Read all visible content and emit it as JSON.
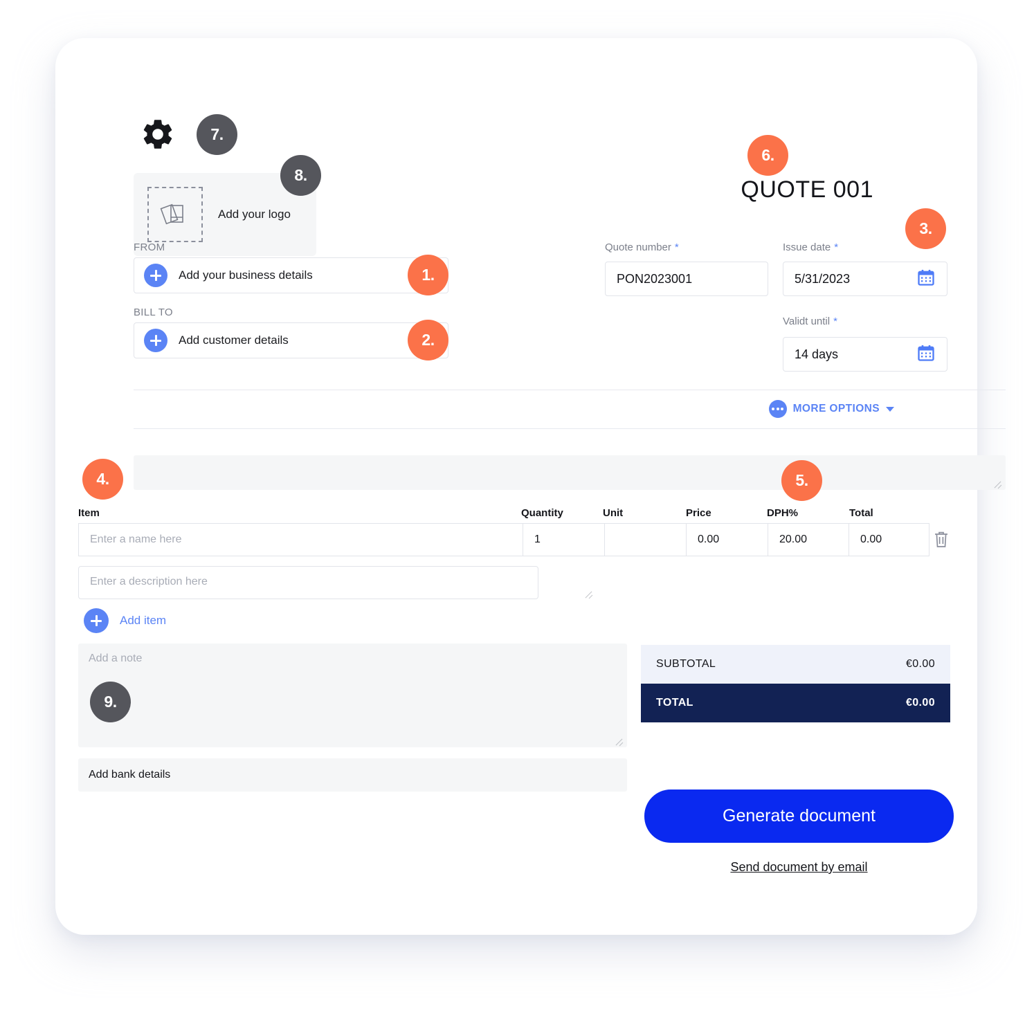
{
  "document": {
    "title": "QUOTE 001"
  },
  "toolbar": {
    "settings_icon": "gear-icon"
  },
  "logo": {
    "label": "Add your logo",
    "icon": "image-stack-icon"
  },
  "parties": {
    "from_label": "FROM",
    "from_action": "Add your business details",
    "bill_to_label": "BILL TO",
    "bill_to_action": "Add customer details"
  },
  "meta_fields": {
    "quote_number": {
      "label": "Quote number",
      "required_mark": "*",
      "value": "PON2023001"
    },
    "issue_date": {
      "label": "Issue date",
      "required_mark": "*",
      "value": "5/31/2023",
      "icon": "calendar-icon"
    },
    "valid_until": {
      "label": "Validt until",
      "required_mark": "*",
      "value": "14 days",
      "icon": "calendar-icon"
    }
  },
  "more_options": {
    "label": "MORE OPTIONS",
    "icon": "dots-icon",
    "caret": "chevron-down-icon"
  },
  "items_table": {
    "columns": [
      "Item",
      "Quantity",
      "Unit",
      "Price",
      "DPH%",
      "Total"
    ],
    "rows": [
      {
        "item_placeholder": "Enter a name here",
        "quantity": "1",
        "unit": "",
        "price": "0.00",
        "dph": "20.00",
        "total": "0.00",
        "delete_icon": "trash-icon"
      }
    ],
    "description_placeholder": "Enter a description here",
    "add_item_label": "Add item"
  },
  "note": {
    "placeholder": "Add a note"
  },
  "bank": {
    "label": "Add bank details"
  },
  "totals": {
    "subtotal_label": "SUBTOTAL",
    "subtotal_value": "€0.00",
    "total_label": "TOTAL",
    "total_value": "€0.00"
  },
  "actions": {
    "generate_label": "Generate document",
    "send_email_label": "Send document by email"
  },
  "annotations": [
    {
      "id": "1",
      "label": "1.",
      "style": "orange"
    },
    {
      "id": "2",
      "label": "2.",
      "style": "orange"
    },
    {
      "id": "3",
      "label": "3.",
      "style": "orange"
    },
    {
      "id": "4",
      "label": "4.",
      "style": "orange"
    },
    {
      "id": "5",
      "label": "5.",
      "style": "orange"
    },
    {
      "id": "6",
      "label": "6.",
      "style": "orange"
    },
    {
      "id": "7",
      "label": "7.",
      "style": "gray"
    },
    {
      "id": "8",
      "label": "8.",
      "style": "gray"
    },
    {
      "id": "9",
      "label": "9.",
      "style": "gray"
    }
  ],
  "colors": {
    "accent_orange": "#FB7249",
    "badge_gray": "#55565C",
    "accent_blue": "#5B84F5",
    "cta_blue": "#0A29F0",
    "total_navy": "#122254",
    "panel_gray": "#F5F6F7",
    "subtotal_bg": "#EFF2FA"
  }
}
